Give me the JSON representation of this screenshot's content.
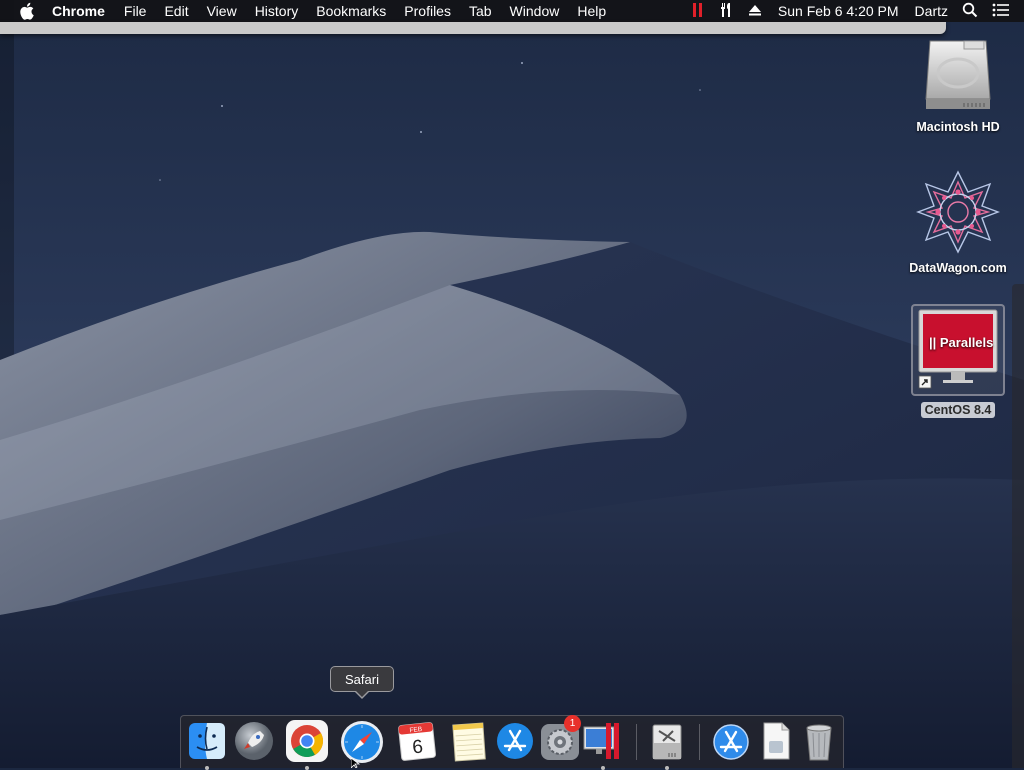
{
  "menubar": {
    "app_name": "Chrome",
    "items": [
      "File",
      "Edit",
      "View",
      "History",
      "Bookmarks",
      "Profiles",
      "Tab",
      "Window",
      "Help"
    ],
    "clock": "Sun Feb 6  4:20 PM",
    "user": "Dartz",
    "status_icons": [
      "parallels-icon",
      "tools-icon",
      "eject-icon",
      "search-icon",
      "notification-list-icon"
    ]
  },
  "desktop": {
    "icons": [
      {
        "label": "Macintosh HD",
        "icon": "hard-drive-icon"
      },
      {
        "label": "DataWagon.com",
        "icon": "star-pattern-icon"
      },
      {
        "label": "CentOS 8.4",
        "icon": "parallels-vm-icon",
        "logo_text": "|| Parallels",
        "selected": true
      }
    ]
  },
  "tooltip": {
    "text": "Safari"
  },
  "dock": {
    "items": [
      {
        "name": "finder-icon",
        "running": true
      },
      {
        "name": "launchpad-icon",
        "running": false
      },
      {
        "name": "chrome-icon",
        "running": true
      },
      {
        "name": "safari-icon",
        "running": false
      },
      {
        "name": "calendar-icon",
        "running": false,
        "month": "FEB",
        "day": "6"
      },
      {
        "name": "notes-icon",
        "running": false
      },
      {
        "name": "app-store-icon",
        "running": false
      },
      {
        "name": "system-preferences-icon",
        "running": false,
        "badge": "1"
      },
      {
        "name": "parallels-desktop-icon",
        "running": true
      },
      {
        "name": "disk-utility-icon",
        "running": true
      },
      {
        "name": "applications-folder-icon",
        "running": false
      },
      {
        "name": "document-icon",
        "running": false
      },
      {
        "name": "trash-icon",
        "running": false
      }
    ]
  },
  "colors": {
    "menubar_bg": "#121216",
    "sky": "#1f2d4a",
    "dune": "#6b7486",
    "badge": "#e8302b",
    "parallels_red": "#c8102e"
  }
}
